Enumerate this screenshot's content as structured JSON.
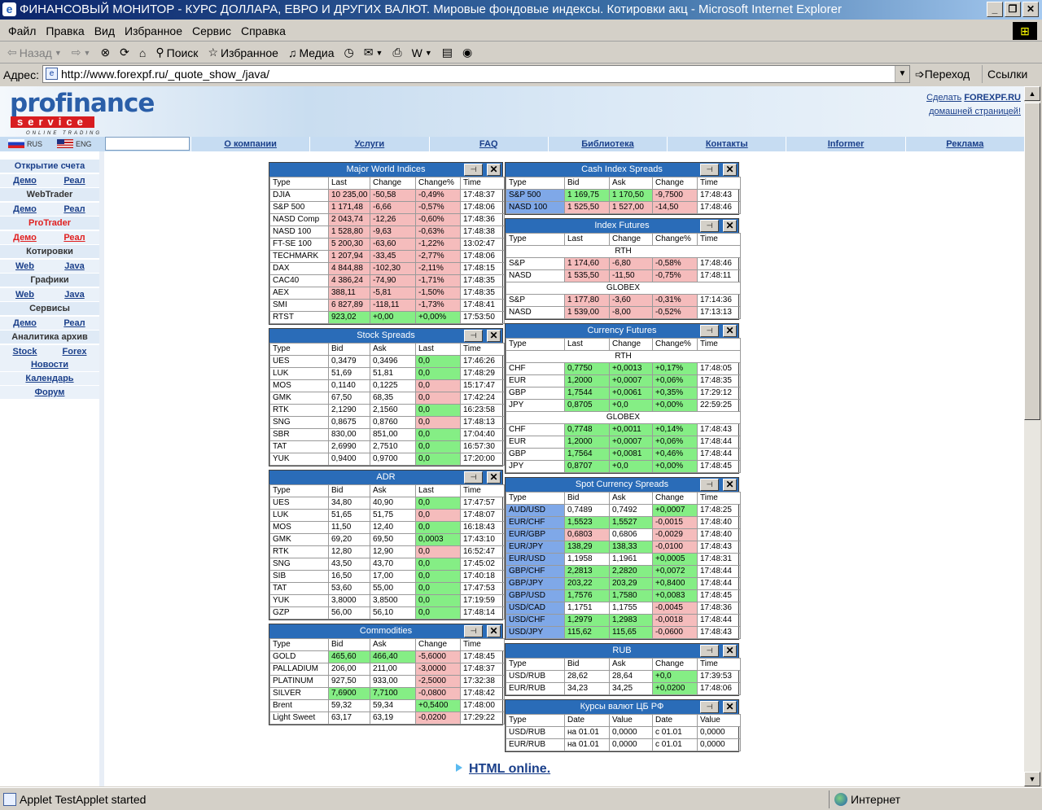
{
  "window": {
    "title": "ФИНАНСОВЫЙ МОНИТОР - КУРС ДОЛЛАРА, ЕВРО И ДРУГИХ ВАЛЮТ. Мировые фондовые индексы. Котировки акц - Microsoft Internet Explorer"
  },
  "menu": [
    "Файл",
    "Правка",
    "Вид",
    "Избранное",
    "Сервис",
    "Справка"
  ],
  "toolbar": {
    "back": "Назад",
    "search": "Поиск",
    "favorites": "Избранное",
    "media": "Медиа"
  },
  "address": {
    "label": "Адрес:",
    "url": "http://www.forexpf.ru/_quote_show_/java/",
    "go": "Переход",
    "links": "Ссылки"
  },
  "status": {
    "text": "Applet TestApplet started",
    "zone": "Интернет"
  },
  "header": {
    "logo1": "profinance",
    "logo2": "service",
    "logo3": "ONLINE TRADING",
    "home1": "Сделать",
    "home_site": "FOREXPF.RU",
    "home2": "домашней страницей!"
  },
  "lang": {
    "ru": "RUS",
    "en": "ENG"
  },
  "nav": [
    "О компании",
    "Услуги",
    "FAQ",
    "Библиотека",
    "Контакты",
    "Informer",
    "Реклама"
  ],
  "sidebar": {
    "open_account": "Открытие счета",
    "demo": "Демо",
    "real": "Реал",
    "webtrader": "WebTrader",
    "protrader": "ProTrader",
    "quotes": "Котировки",
    "web": "Web",
    "java": "Java",
    "charts": "Графики",
    "services": "Сервисы",
    "archive": "Аналитика архив",
    "stock": "Stock",
    "forex": "Forex",
    "news": "Новости",
    "calendar": "Календарь",
    "forum": "Форум"
  },
  "footer_link": "HTML online.",
  "panels": {
    "major": {
      "title": "Major World Indices",
      "cols": [
        "Type",
        "Last",
        "Change",
        "Change%",
        "Time"
      ],
      "rows": [
        [
          "DJIA",
          "10 235,00",
          "-50,58",
          "-0,49%",
          "17:48:37",
          "r"
        ],
        [
          "S&P 500",
          "1 171,48",
          "-6,66",
          "-0,57%",
          "17:48:06",
          "r"
        ],
        [
          "NASD Comp",
          "2 043,74",
          "-12,26",
          "-0,60%",
          "17:48:36",
          "r"
        ],
        [
          "NASD 100",
          "1 528,80",
          "-9,63",
          "-0,63%",
          "17:48:38",
          "r"
        ],
        [
          "FT-SE 100",
          "5 200,30",
          "-63,60",
          "-1,22%",
          "13:02:47",
          "r"
        ],
        [
          "TECHMARK",
          "1 207,94",
          "-33,45",
          "-2,77%",
          "17:48:06",
          "r"
        ],
        [
          "DAX",
          "4 844,88",
          "-102,30",
          "-2,11%",
          "17:48:15",
          "r"
        ],
        [
          "CAC40",
          "4 386,24",
          "-74,90",
          "-1,71%",
          "17:48:35",
          "r"
        ],
        [
          "AEX",
          "388,11",
          "-5,81",
          "-1,50%",
          "17:48:35",
          "r"
        ],
        [
          "SMI",
          "6 827,89",
          "-118,11",
          "-1,73%",
          "17:48:41",
          "r"
        ],
        [
          "RTST",
          "923,02",
          "+0,00",
          "+0,00%",
          "17:53:50",
          "g"
        ]
      ]
    },
    "stock": {
      "title": "Stock Spreads",
      "cols": [
        "Type",
        "Bid",
        "Ask",
        "Last",
        "Time"
      ],
      "rows": [
        [
          "UES",
          "0,3479",
          "0,3496",
          "0,0",
          "17:46:26",
          "g"
        ],
        [
          "LUK",
          "51,69",
          "51,81",
          "0,0",
          "17:48:29",
          "g"
        ],
        [
          "MOS",
          "0,1140",
          "0,1225",
          "0,0",
          "15:17:47",
          "r"
        ],
        [
          "GMK",
          "67,50",
          "68,35",
          "0,0",
          "17:42:24",
          "r"
        ],
        [
          "RTK",
          "2,1290",
          "2,1560",
          "0,0",
          "16:23:58",
          "g"
        ],
        [
          "SNG",
          "0,8675",
          "0,8760",
          "0,0",
          "17:48:13",
          "r"
        ],
        [
          "SBR",
          "830,00",
          "851,00",
          "0,0",
          "17:04:40",
          "g"
        ],
        [
          "TAT",
          "2,6990",
          "2,7510",
          "0,0",
          "16:57:30",
          "g"
        ],
        [
          "YUK",
          "0,9400",
          "0,9700",
          "0,0",
          "17:20:00",
          "g"
        ]
      ]
    },
    "adr": {
      "title": "ADR",
      "cols": [
        "Type",
        "Bid",
        "Ask",
        "Last",
        "Time"
      ],
      "rows": [
        [
          "UES",
          "34,80",
          "40,90",
          "0,0",
          "17:47:57",
          "g"
        ],
        [
          "LUK",
          "51,65",
          "51,75",
          "0,0",
          "17:48:07",
          "r"
        ],
        [
          "MOS",
          "11,50",
          "12,40",
          "0,0",
          "16:18:43",
          "g"
        ],
        [
          "GMK",
          "69,20",
          "69,50",
          "0,0003",
          "17:43:10",
          "g"
        ],
        [
          "RTK",
          "12,80",
          "12,90",
          "0,0",
          "16:52:47",
          "r"
        ],
        [
          "SNG",
          "43,50",
          "43,70",
          "0,0",
          "17:45:02",
          "g"
        ],
        [
          "SIB",
          "16,50",
          "17,00",
          "0,0",
          "17:40:18",
          "g"
        ],
        [
          "TAT",
          "53,60",
          "55,00",
          "0,0",
          "17:47:53",
          "g"
        ],
        [
          "YUK",
          "3,8000",
          "3,8500",
          "0,0",
          "17:19:59",
          "g"
        ],
        [
          "GZP",
          "56,00",
          "56,10",
          "0,0",
          "17:48:14",
          "g"
        ]
      ]
    },
    "commod": {
      "title": "Commodities",
      "cols": [
        "Type",
        "Bid",
        "Ask",
        "Change",
        "Time"
      ],
      "rows": [
        [
          "GOLD",
          "465,60",
          "466,40",
          "-5,6000",
          "17:48:45",
          "g",
          "g",
          "r"
        ],
        [
          "PALLADIUM",
          "206,00",
          "211,00",
          "-3,0000",
          "17:48:37",
          "",
          "",
          "r"
        ],
        [
          "PLATINUM",
          "927,50",
          "933,00",
          "-2,5000",
          "17:32:38",
          "",
          "",
          "r"
        ],
        [
          "SILVER",
          "7,6900",
          "7,7100",
          "-0,0800",
          "17:48:42",
          "g",
          "g",
          "r"
        ],
        [
          "Brent",
          "59,32",
          "59,34",
          "+0,5400",
          "17:48:00",
          "",
          "",
          "g"
        ],
        [
          "Light Sweet",
          "63,17",
          "63,19",
          "-0,0200",
          "17:29:22",
          "",
          "",
          "r"
        ]
      ]
    },
    "cash": {
      "title": "Cash Index Spreads",
      "cols": [
        "Type",
        "Bid",
        "Ask",
        "Change",
        "Time"
      ],
      "rows": [
        [
          "S&P 500",
          "1 169,75",
          "1 170,50",
          "-9,7500",
          "17:48:43",
          "g",
          "g",
          "r"
        ],
        [
          "NASD 100",
          "1 525,50",
          "1 527,00",
          "-14,50",
          "17:48:46",
          "r",
          "r",
          "r"
        ]
      ]
    },
    "futures": {
      "title": "Index Futures",
      "cols": [
        "Type",
        "Last",
        "Change",
        "Change%",
        "Time"
      ],
      "sec1": "RTH",
      "sec2": "GLOBEX",
      "rows1": [
        [
          "S&P",
          "1 174,60",
          "-6,80",
          "-0,58%",
          "17:48:46"
        ],
        [
          "NASD",
          "1 535,50",
          "-11,50",
          "-0,75%",
          "17:48:11"
        ]
      ],
      "rows2": [
        [
          "S&P",
          "1 177,80",
          "-3,60",
          "-0,31%",
          "17:14:36"
        ],
        [
          "NASD",
          "1 539,00",
          "-8,00",
          "-0,52%",
          "17:13:13"
        ]
      ]
    },
    "curfut": {
      "title": "Currency Futures",
      "cols": [
        "Type",
        "Last",
        "Change",
        "Change%",
        "Time"
      ],
      "sec1": "RTH",
      "sec2": "GLOBEX",
      "rows1": [
        [
          "CHF",
          "0,7750",
          "+0,0013",
          "+0,17%",
          "17:48:05"
        ],
        [
          "EUR",
          "1,2000",
          "+0,0007",
          "+0,06%",
          "17:48:35"
        ],
        [
          "GBP",
          "1,7544",
          "+0,0061",
          "+0,35%",
          "17:29:12"
        ],
        [
          "JPY",
          "0,8705",
          "+0,0",
          "+0,00%",
          "22:59:25"
        ]
      ],
      "rows2": [
        [
          "CHF",
          "0,7748",
          "+0,0011",
          "+0,14%",
          "17:48:43"
        ],
        [
          "EUR",
          "1,2000",
          "+0,0007",
          "+0,06%",
          "17:48:44"
        ],
        [
          "GBP",
          "1,7564",
          "+0,0081",
          "+0,46%",
          "17:48:44"
        ],
        [
          "JPY",
          "0,8707",
          "+0,0",
          "+0,00%",
          "17:48:45"
        ]
      ]
    },
    "spot": {
      "title": "Spot Currency Spreads",
      "cols": [
        "Type",
        "Bid",
        "Ask",
        "Change",
        "Time"
      ],
      "rows": [
        [
          "AUD/USD",
          "0,7489",
          "0,7492",
          "+0,0007",
          "17:48:25",
          "",
          "",
          "g"
        ],
        [
          "EUR/CHF",
          "1,5523",
          "1,5527",
          "-0,0015",
          "17:48:40",
          "g",
          "g",
          "r"
        ],
        [
          "EUR/GBP",
          "0,6803",
          "0,6806",
          "-0,0029",
          "17:48:40",
          "r",
          "",
          "r"
        ],
        [
          "EUR/JPY",
          "138,29",
          "138,33",
          "-0,0100",
          "17:48:43",
          "g",
          "g",
          "r"
        ],
        [
          "EUR/USD",
          "1,1958",
          "1,1961",
          "+0,0005",
          "17:48:31",
          "",
          "",
          "g"
        ],
        [
          "GBP/CHF",
          "2,2813",
          "2,2820",
          "+0,0072",
          "17:48:44",
          "g",
          "g",
          "g"
        ],
        [
          "GBP/JPY",
          "203,22",
          "203,29",
          "+0,8400",
          "17:48:44",
          "g",
          "g",
          "g"
        ],
        [
          "GBP/USD",
          "1,7576",
          "1,7580",
          "+0,0083",
          "17:48:45",
          "g",
          "g",
          "g"
        ],
        [
          "USD/CAD",
          "1,1751",
          "1,1755",
          "-0,0045",
          "17:48:36",
          "",
          "",
          "r"
        ],
        [
          "USD/CHF",
          "1,2979",
          "1,2983",
          "-0,0018",
          "17:48:44",
          "g",
          "g",
          "r"
        ],
        [
          "USD/JPY",
          "115,62",
          "115,65",
          "-0,0600",
          "17:48:43",
          "g",
          "g",
          "r"
        ]
      ]
    },
    "rub": {
      "title": "RUB",
      "cols": [
        "Type",
        "Bid",
        "Ask",
        "Change",
        "Time"
      ],
      "rows": [
        [
          "USD/RUB",
          "28,62",
          "28,64",
          "+0,0",
          "17:39:53",
          "",
          "",
          "g"
        ],
        [
          "EUR/RUB",
          "34,23",
          "34,25",
          "+0,0200",
          "17:48:06",
          "",
          "",
          "g"
        ]
      ]
    },
    "cbr": {
      "title": "Курсы валют ЦБ РФ",
      "cols": [
        "Type",
        "Date",
        "Value",
        "Date",
        "Value"
      ],
      "rows": [
        [
          "USD/RUB",
          "на 01.01",
          "0,0000",
          "с 01.01",
          "0,0000"
        ],
        [
          "EUR/RUB",
          "на 01.01",
          "0,0000",
          "с 01.01",
          "0,0000"
        ]
      ]
    }
  }
}
